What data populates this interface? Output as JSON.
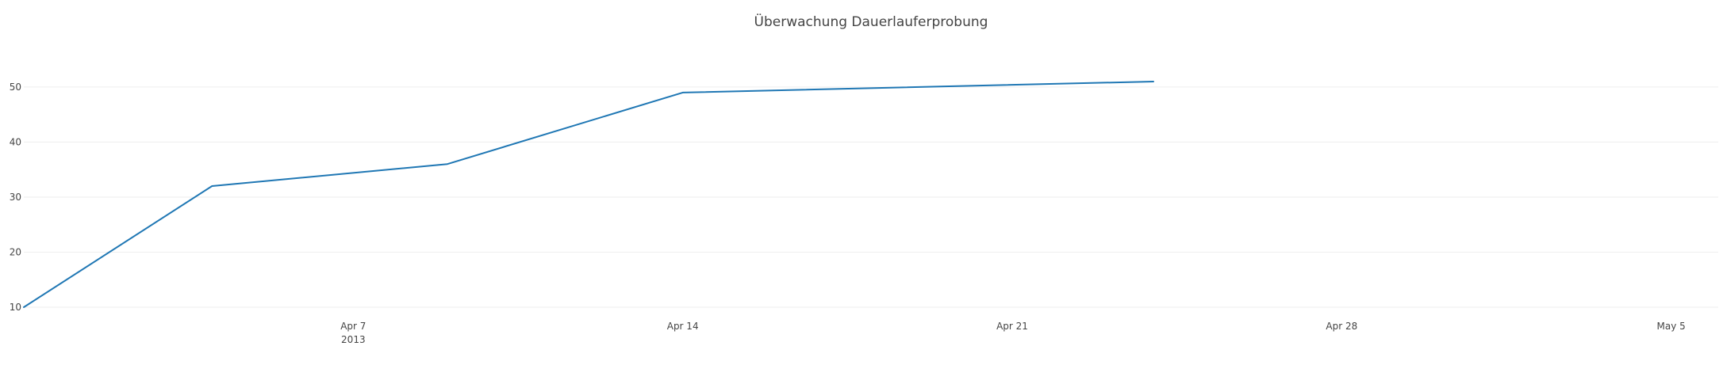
{
  "chart_data": {
    "type": "line",
    "title": "Überwachung Dauerlauferprobung",
    "xlabel": "",
    "ylabel": "",
    "x_axis_type": "date",
    "xlim": [
      "2013-03-31",
      "2013-05-06"
    ],
    "ylim": [
      10,
      52
    ],
    "grid": true,
    "legend": "none",
    "x_ticks": [
      {
        "date": "2013-04-07",
        "label": "Apr 7",
        "sublabel": "2013"
      },
      {
        "date": "2013-04-14",
        "label": "Apr 14"
      },
      {
        "date": "2013-04-21",
        "label": "Apr 21"
      },
      {
        "date": "2013-04-28",
        "label": "Apr 28"
      },
      {
        "date": "2013-05-05",
        "label": "May 5"
      }
    ],
    "y_ticks": [
      10,
      20,
      30,
      40,
      50
    ],
    "series": [
      {
        "color": "#1f77b4",
        "points": [
          {
            "x": "2013-03-31",
            "y": 10
          },
          {
            "x": "2013-04-04",
            "y": 32
          },
          {
            "x": "2013-04-09",
            "y": 36
          },
          {
            "x": "2013-04-14",
            "y": 49
          },
          {
            "x": "2013-04-24",
            "y": 51
          }
        ]
      }
    ]
  }
}
